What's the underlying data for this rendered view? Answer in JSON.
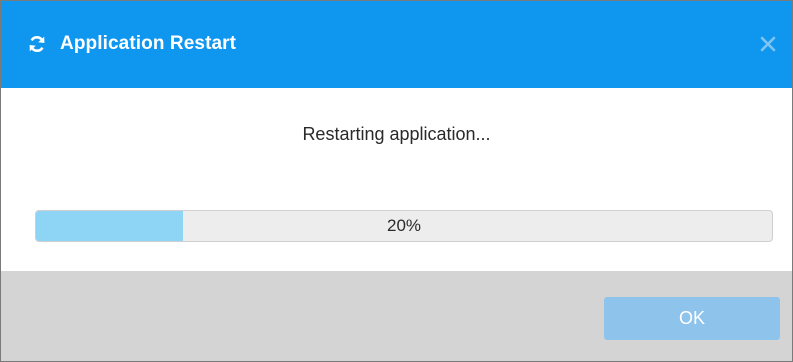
{
  "dialog": {
    "title": "Application Restart",
    "title_icon": "refresh-icon",
    "close_icon": "close-icon",
    "accent_color": "#0f96ef"
  },
  "body": {
    "message": "Restarting application...",
    "progress": {
      "value": 20,
      "label": "20%",
      "fill_color": "#8ed4f5"
    }
  },
  "footer": {
    "ok_label": "OK",
    "ok_disabled": true
  }
}
